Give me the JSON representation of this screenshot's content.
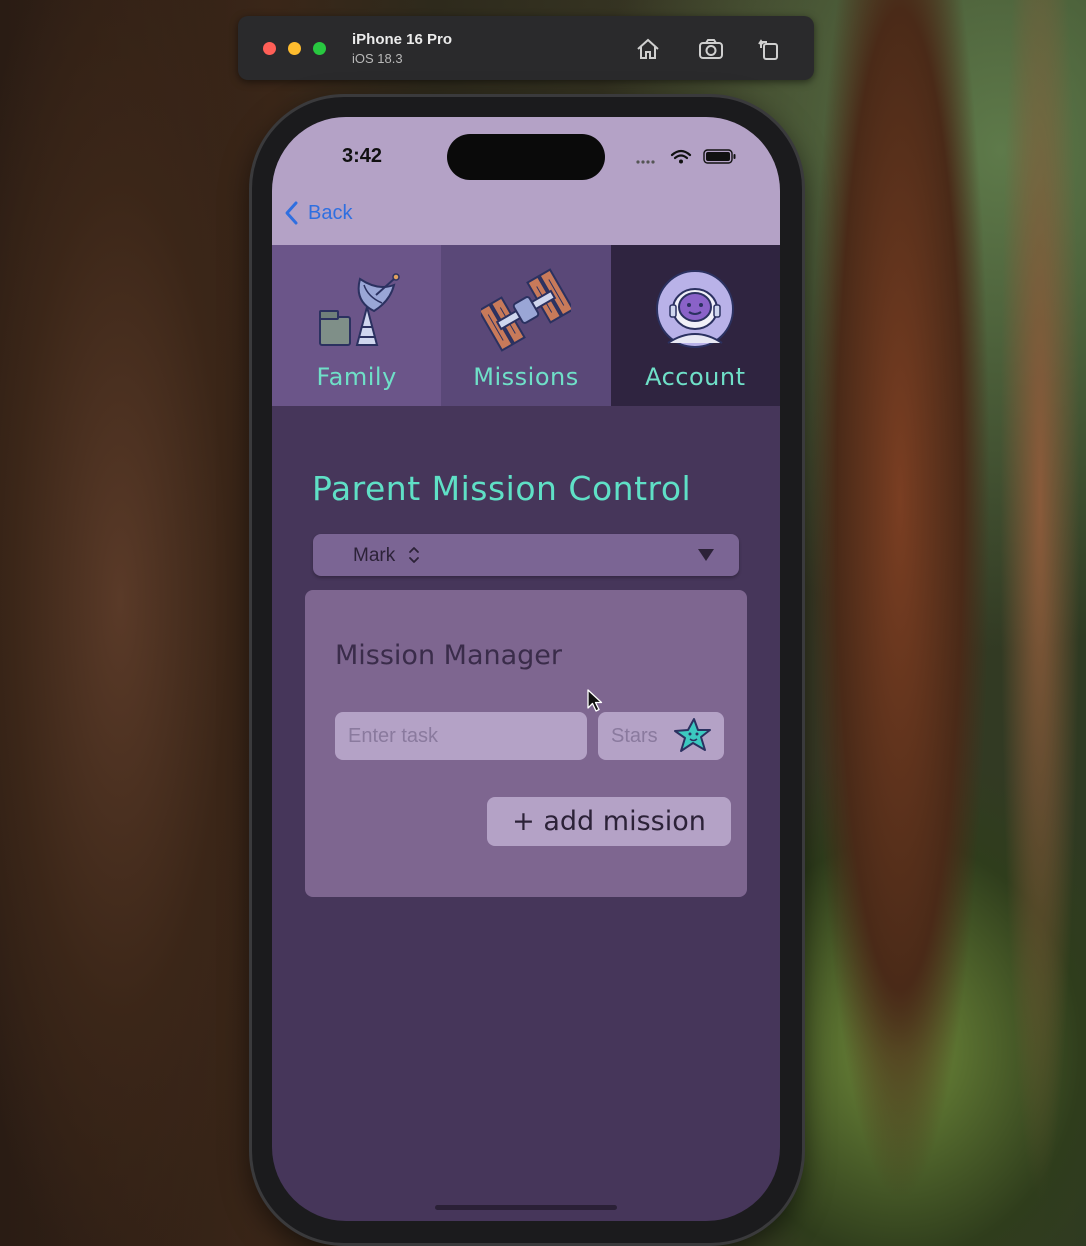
{
  "simulator": {
    "device_name": "iPhone 16 Pro",
    "os_version": "iOS 18.3",
    "toolbar_icons": [
      "home-icon",
      "screenshot-icon",
      "rotate-icon"
    ]
  },
  "status_bar": {
    "time": "3:42"
  },
  "nav": {
    "back_label": "Back"
  },
  "tabs": [
    {
      "label": "Family",
      "icon": "satellite-dish-icon"
    },
    {
      "label": "Missions",
      "icon": "space-station-icon"
    },
    {
      "label": "Account",
      "icon": "astronaut-icon"
    }
  ],
  "page": {
    "title": "Parent Mission Control"
  },
  "child_picker": {
    "selected": "Mark"
  },
  "mission_manager": {
    "title": "Mission Manager",
    "task_placeholder": "Enter task",
    "stars_placeholder": "Stars",
    "add_button_label": "+ add mission"
  },
  "colors": {
    "accent": "#5fe0c6",
    "status_bar_bg": "#b4a2c6",
    "page_bg": "#46365a",
    "card_bg": "#7e6690",
    "link": "#2f6fe0"
  }
}
